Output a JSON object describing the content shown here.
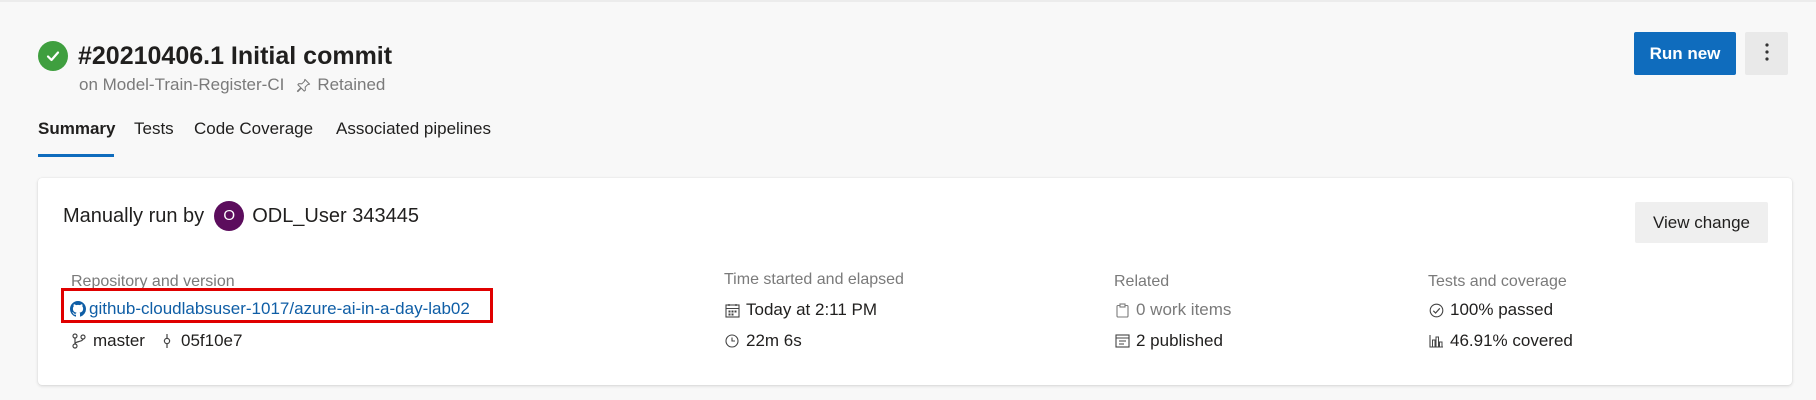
{
  "run": {
    "title": "#20210406.1 Initial commit",
    "pipeline": "on Model-Train-Register-CI",
    "retained": "Retained",
    "status": "succeeded"
  },
  "actions": {
    "run_new": "Run new",
    "view_change": "View change"
  },
  "tabs": [
    {
      "label": "Summary",
      "active": true
    },
    {
      "label": "Tests",
      "active": false
    },
    {
      "label": "Code Coverage",
      "active": false
    },
    {
      "label": "Associated pipelines",
      "active": false
    }
  ],
  "summary": {
    "manual_prefix": "Manually run by",
    "avatar_initial": "O",
    "user": "ODL_User 343445",
    "repo_label": "Repository and version",
    "repo_link": "github-cloudlabsuser-1017/azure-ai-in-a-day-lab02",
    "branch": "master",
    "commit": "05f10e7",
    "time_label": "Time started and elapsed",
    "started": "Today at 2:11 PM",
    "elapsed": "22m 6s",
    "related_label": "Related",
    "work_items": "0 work items",
    "published": "2 published",
    "tests_label": "Tests and coverage",
    "tests_passed": "100% passed",
    "coverage": "46.91% covered"
  },
  "colors": {
    "accent": "#0f6cbd",
    "success": "#3f9f3f",
    "avatar": "#5c0d5d",
    "highlight": "#e00000"
  }
}
